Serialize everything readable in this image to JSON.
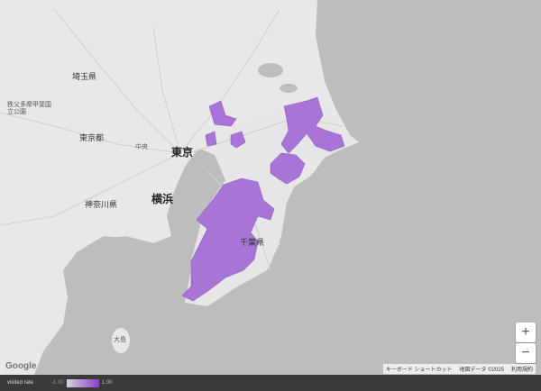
{
  "map": {
    "places": {
      "saitama": "埼玉県",
      "tokyo_to": "東京都",
      "tokyo": "東京",
      "kanagawa": "神奈川県",
      "yokohama": "横浜",
      "chiba": "千葉県",
      "chichibu": "秩父多摩甲斐国立公園",
      "chuo": "中央",
      "oshima": "大島"
    }
  },
  "controls": {
    "zoom_in": "+",
    "zoom_out": "−"
  },
  "attribution": {
    "shortcuts": "キーボード ショートカット",
    "map_data": "地図データ ©2025",
    "terms": "利用規約",
    "logo": "Google"
  },
  "legend": {
    "label": "visited rate",
    "min": "-1.00",
    "max": "1.00",
    "color_low": "#d6d1dc",
    "color_high": "#8b3fc6"
  },
  "colors": {
    "land": "#e8e8e8",
    "sea": "#bdbdbd",
    "visited": "#a874d8"
  }
}
